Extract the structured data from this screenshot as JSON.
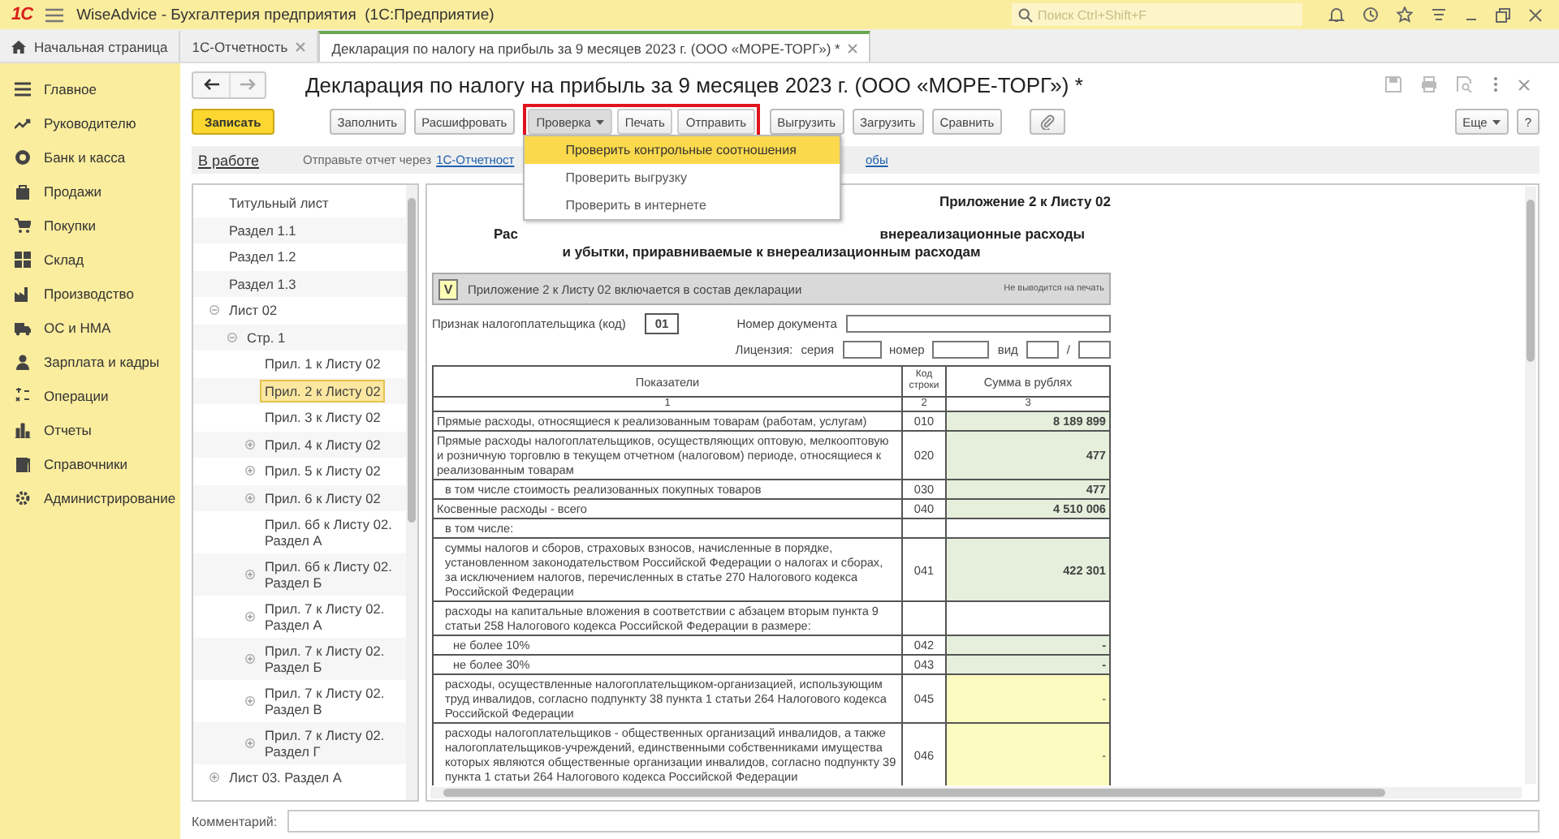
{
  "app_bar": {
    "logo": "1С",
    "title": "WiseAdvice - Бухгалтерия предприятия  (1С:Предприятие)",
    "search": {
      "placeholder": "Поиск Ctrl+Shift+F"
    }
  },
  "tabs": [
    {
      "kind": "home",
      "label": "Начальная страница",
      "selected": false,
      "closable": false
    },
    {
      "kind": "document",
      "label": "1С-Отчетность",
      "selected": false,
      "closable": true
    },
    {
      "kind": "document",
      "label": "Декларация по налогу на прибыль за 9 месяцев 2023 г. (ООО «МОРЕ-ТОРГ») *",
      "selected": true,
      "closable": true
    }
  ],
  "sidebar": {
    "items": [
      {
        "label": "Главное",
        "selected": false
      },
      {
        "label": "Руководителю",
        "selected": false
      },
      {
        "label": "Банк и касса",
        "selected": false
      },
      {
        "label": "Продажи",
        "selected": false
      },
      {
        "label": "Покупки",
        "selected": false
      },
      {
        "label": "Склад",
        "selected": false
      },
      {
        "label": "Производство",
        "selected": false
      },
      {
        "label": "ОС и НМА",
        "selected": false
      },
      {
        "label": "Зарплата и кадры",
        "selected": false
      },
      {
        "label": "Операции",
        "selected": false
      },
      {
        "label": "Отчеты",
        "selected": false
      },
      {
        "label": "Справочники",
        "selected": false
      },
      {
        "label": "Администрирование",
        "selected": false
      }
    ]
  },
  "document": {
    "title": "Декларация по налогу на прибыль за 9 месяцев 2023 г. (ООО «МОРЕ-ТОРГ») *",
    "toolbar": {
      "left": [
        {
          "label": "Записать",
          "kind": "primary"
        },
        {
          "label": "Заполнить",
          "kind": "plain"
        },
        {
          "label": "Расшифровать",
          "kind": "plain"
        }
      ],
      "highlighted_group": {
        "highlighted": true,
        "buttons": [
          {
            "label": "Проверка",
            "kind": "dropdown",
            "expanded": true
          },
          {
            "label": "Печать",
            "kind": "plain"
          },
          {
            "label": "Отправить",
            "kind": "plain"
          }
        ]
      },
      "middle": [
        {
          "label": "Выгрузить",
          "kind": "plain"
        },
        {
          "label": "Загрузить",
          "kind": "plain"
        },
        {
          "label": "Сравнить",
          "kind": "plain"
        },
        {
          "kind": "attach"
        }
      ],
      "right": [
        {
          "label": "Еще",
          "kind": "dropdown",
          "expanded": false
        },
        {
          "label": "?",
          "kind": "plain"
        }
      ]
    },
    "check_menu": {
      "items": [
        {
          "label": "Проверить контрольные соотношения",
          "selected": true
        },
        {
          "label": "Проверить выгрузку",
          "selected": false
        },
        {
          "label": "Проверить в интернете",
          "selected": false
        }
      ]
    },
    "status": {
      "state": "В работе",
      "hint": "Отправьте отчет через",
      "link": "1С-Отчетност",
      "link_tail": "обы"
    },
    "tree": [
      {
        "label": "Титульный лист",
        "selected": false
      },
      {
        "label": "Раздел 1.1",
        "selected": false
      },
      {
        "label": "Раздел 1.2",
        "selected": false
      },
      {
        "label": "Раздел 1.3",
        "selected": false
      },
      {
        "label": "Лист 02",
        "selected": false,
        "expanded": true,
        "children": [
          {
            "label": "Стр. 1",
            "selected": false,
            "expanded": true,
            "children": [
              {
                "label": "Прил. 1 к Листу 02",
                "selected": false
              },
              {
                "label": "Прил. 2 к Листу 02",
                "selected": true
              },
              {
                "label": "Прил. 3 к Листу 02",
                "selected": false
              },
              {
                "label": "Прил. 4 к Листу 02",
                "selected": false,
                "expanded": false
              },
              {
                "label": "Прил. 5 к Листу 02",
                "selected": false,
                "expanded": false
              },
              {
                "label": "Прил. 6 к Листу 02",
                "selected": false,
                "expanded": false
              },
              {
                "label": "Прил. 6б к Листу 02. Раздел А",
                "selected": false
              },
              {
                "label": "Прил. 6б к Листу 02. Раздел Б",
                "selected": false,
                "expanded": false
              },
              {
                "label": "Прил. 7 к Листу 02. Раздел А",
                "selected": false,
                "expanded": false
              },
              {
                "label": "Прил. 7 к Листу 02. Раздел Б",
                "selected": false,
                "expanded": false
              },
              {
                "label": "Прил. 7 к Листу 02. Раздел В",
                "selected": false,
                "expanded": false
              },
              {
                "label": "Прил. 7 к Листу 02. Раздел Г",
                "selected": false,
                "expanded": false
              }
            ]
          }
        ]
      },
      {
        "label": "Лист 03. Раздел А",
        "selected": false,
        "expanded": false
      }
    ],
    "form": {
      "sheet_label": "Приложение 2 к Листу 02",
      "heading_start": "Рас",
      "heading_end": "внереализационные расходы",
      "heading_line_2": "и убытки, приравниваемые к внереализационным расходам",
      "include": {
        "checked": true,
        "mark": "V",
        "label": "Приложение 2 к Листу 02 включается в состав декларации",
        "note": "Не выводится на печать"
      },
      "taxpayer_code": {
        "label": "Признак налогоплательщика (код)",
        "value": "01"
      },
      "document_number": {
        "label": "Номер документа"
      },
      "license": {
        "label": "Лицензия:",
        "series_label": "серия",
        "number_label": "номер",
        "kind_label": "вид",
        "separator": "/"
      },
      "table": {
        "columns": [
          "Показатели",
          "Код строки",
          "Сумма в рублях"
        ],
        "column_numbers": [
          "1",
          "2",
          "3"
        ],
        "rows": [
          {
            "label": "Прямые расходы, относящиеся к реализованным товарам (работам, услугам)",
            "code": "010",
            "value": "8 189 899",
            "kind": "calculated"
          },
          {
            "label": "Прямые расходы налогоплательщиков, осуществляющих оптовую, мелкооптовую и розничную торговлю в текущем отчетном (налоговом) периоде, относящиеся к реализованным товарам",
            "code": "020",
            "value": "477",
            "kind": "calculated",
            "children": [
              {
                "label": "в том числе стоимость реализованных покупных товаров",
                "code": "030",
                "value": "477",
                "kind": "calculated"
              }
            ]
          },
          {
            "label": "Косвенные расходы - всего",
            "code": "040",
            "value": "4 510 006",
            "kind": "calculated",
            "children": [
              {
                "label": "в том числе:",
                "kind": "text"
              },
              {
                "label": "суммы налогов и сборов, страховых взносов, начисленные в порядке, установленном законодательством Российской Федерации о налогах и сборах, за исключением налогов, перечисленных в статье 270 Налогового кодекса Российской Федерации",
                "code": "041",
                "value": "422 301",
                "kind": "calculated"
              },
              {
                "label": "расходы на капитальные вложения в соответствии с абзацем вторым пункта 9 статьи 258 Налогового кодекса Российской Федерации в размере:",
                "kind": "text",
                "children": [
                  {
                    "label": "не более 10%",
                    "code": "042",
                    "value": "-",
                    "kind": "calculated"
                  },
                  {
                    "label": "не более 30%",
                    "code": "043",
                    "value": "-",
                    "kind": "calculated"
                  }
                ]
              },
              {
                "label": "расходы, осуществленные налогоплательщиком-организацией, использующим труд инвалидов, согласно подпункту 38 пункта 1 статьи 264 Налогового кодекса Российской Федерации",
                "code": "045",
                "value": "-",
                "kind": "manual"
              },
              {
                "label": "расходы налогоплательщиков - общественных организаций инвалидов, а также налогоплательщиков-учреждений, единственными собственниками имущества которых являются общественные организации инвалидов, согласно подпункту 39 пункта 1 статьи 264 Налогового кодекса Российской Федерации",
                "code": "046",
                "value": "-",
                "kind": "manual"
              }
            ]
          }
        ]
      }
    },
    "comment": {
      "label": "Комментарий:"
    }
  }
}
